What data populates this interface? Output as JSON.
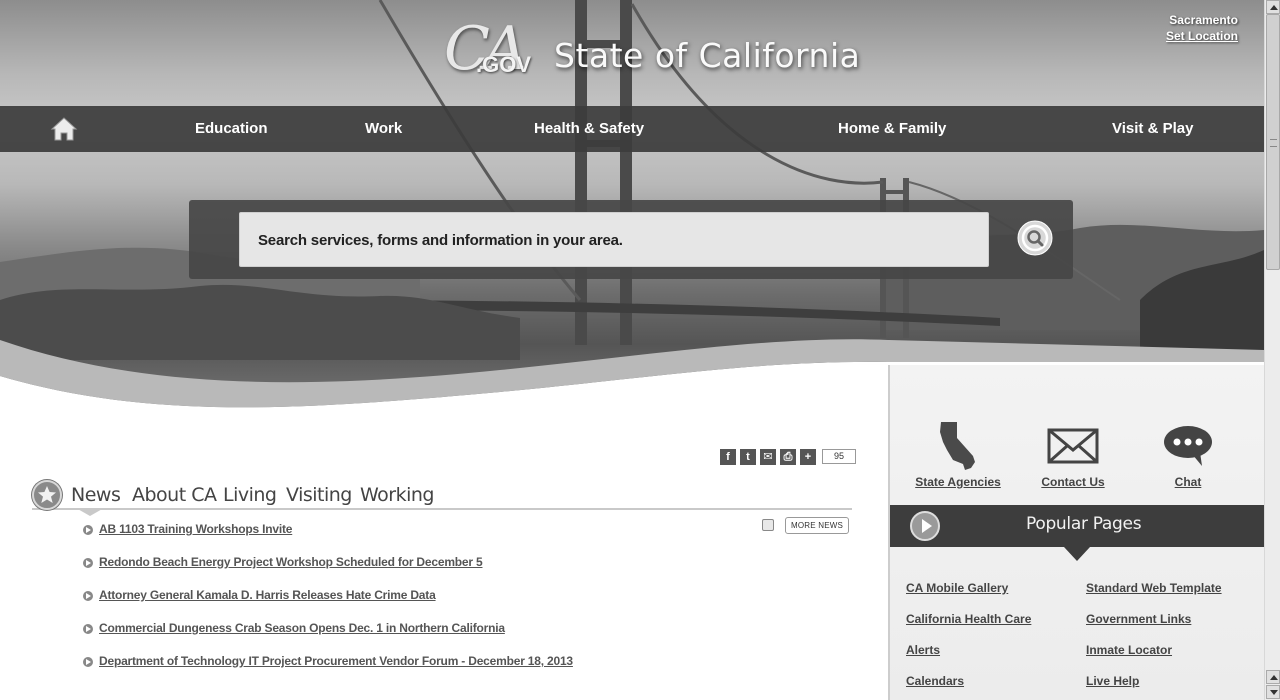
{
  "header": {
    "logo_ca": "CA",
    "logo_gov": ".GOV",
    "site_title": "State of California",
    "location_city": "Sacramento",
    "location_link": "Set Location"
  },
  "nav": {
    "home_icon": "home-icon",
    "items": [
      {
        "label": "Education"
      },
      {
        "label": "Work"
      },
      {
        "label": "Health & Safety"
      },
      {
        "label": "Home & Family"
      },
      {
        "label": "Visit & Play"
      }
    ]
  },
  "search": {
    "placeholder": "Search services, forms and information in your area.",
    "button_icon": "search-icon"
  },
  "share": {
    "icons": [
      "facebook-icon",
      "twitter-icon",
      "email-icon",
      "print-icon",
      "add-icon"
    ],
    "count": "95"
  },
  "tabs": [
    {
      "label": "News"
    },
    {
      "label": "About CA"
    },
    {
      "label": "Living"
    },
    {
      "label": "Visiting"
    },
    {
      "label": "Working"
    }
  ],
  "news": {
    "more_label": "MORE NEWS",
    "items": [
      {
        "title": "AB 1103 Training Workshops Invite"
      },
      {
        "title": "Redondo Beach Energy Project Workshop Scheduled for December 5"
      },
      {
        "title": "Attorney General Kamala D. Harris Releases Hate Crime Data"
      },
      {
        "title": "Commercial Dungeness Crab Season Opens Dec. 1 in Northern California"
      },
      {
        "title": "Department of Technology IT Project Procurement Vendor Forum - December 18, 2013"
      }
    ]
  },
  "quick_links": [
    {
      "label": "State Agencies",
      "icon": "california-map-icon"
    },
    {
      "label": "Contact Us",
      "icon": "envelope-icon"
    },
    {
      "label": "Chat",
      "icon": "chat-bubble-icon"
    }
  ],
  "popular": {
    "title": "Popular Pages",
    "left": [
      "CA Mobile Gallery",
      "California Health Care",
      "Alerts",
      "Calendars"
    ],
    "right": [
      "Standard Web Template",
      "Government Links",
      "Inmate Locator",
      "Live Help"
    ]
  },
  "colors": {
    "nav_bg": "#3c3c3c",
    "link": "#444444",
    "panel_bg": "#ececec"
  }
}
